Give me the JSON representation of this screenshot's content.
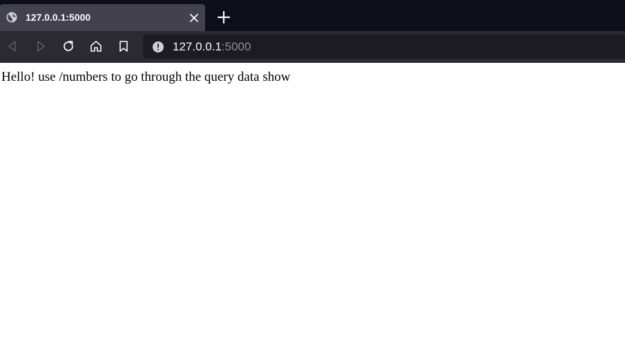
{
  "browser": {
    "tab": {
      "title": "127.0.0.1:5000"
    },
    "address_bar": {
      "host": "127.0.0.1",
      "port": ":5000"
    }
  },
  "page": {
    "body_text": "Hello! use /numbers to go through the query data show"
  },
  "icons": {
    "tab_favicon": "globe-icon",
    "tab_close": "close-icon",
    "new_tab": "plus-icon",
    "back": "back-arrow-icon",
    "forward": "forward-arrow-icon",
    "reload": "reload-icon",
    "home": "home-icon",
    "bookmark": "bookmark-icon",
    "site_info": "info-icon"
  },
  "colors": {
    "tabstrip_bg": "#0e0d1a",
    "toolbar_bg": "#2b2a33",
    "active_tab_bg": "#42414d",
    "urlbar_bg": "#1c1b22",
    "text_light": "#fbfbfe",
    "text_dim": "#8f8f9d",
    "page_bg": "#ffffff"
  }
}
